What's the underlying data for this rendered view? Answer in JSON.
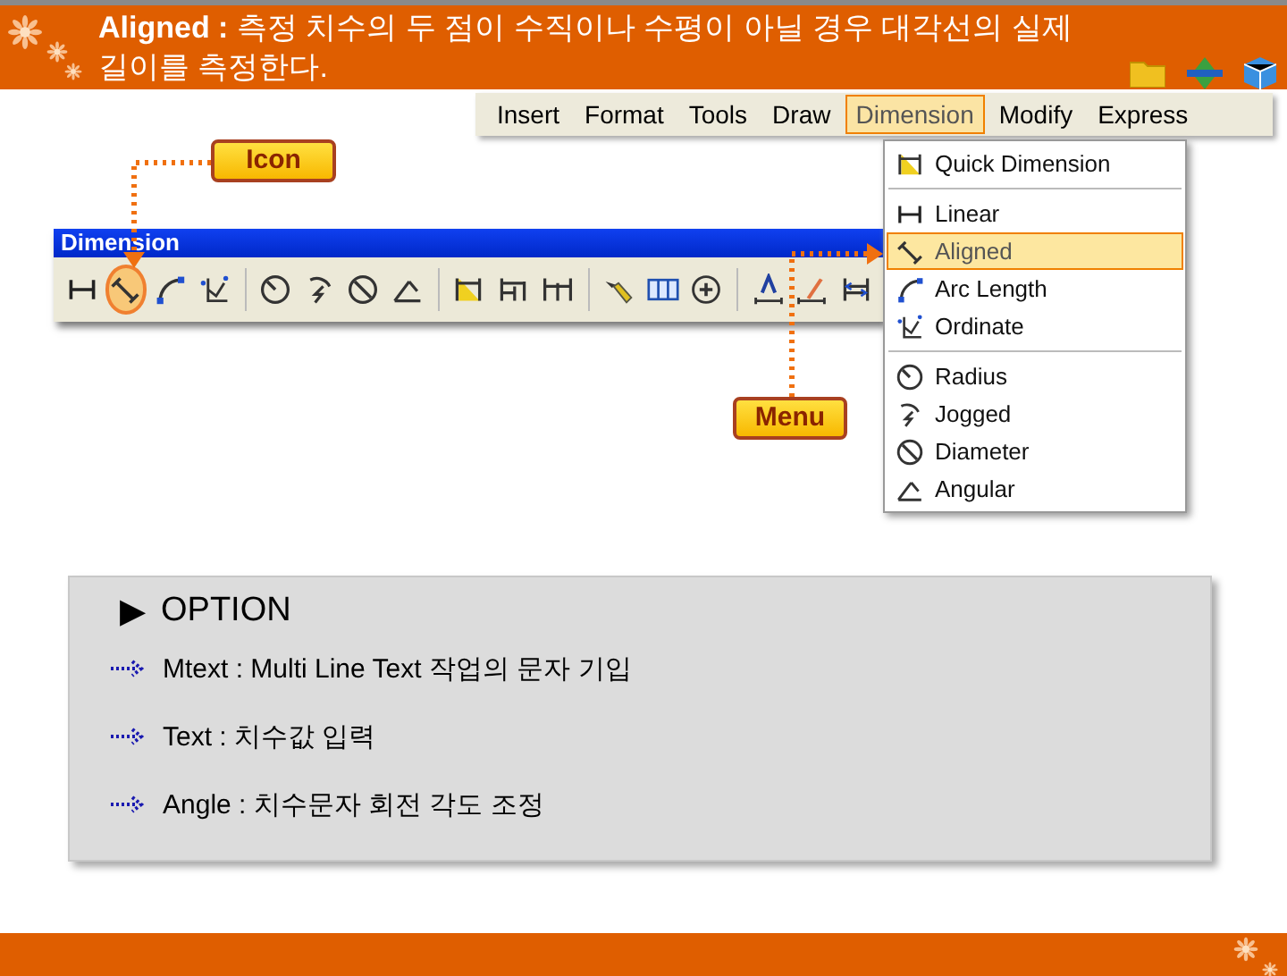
{
  "header": {
    "title": "**Aligned :** 측정 치수의 두 점이 수직이나 수평이 아닐 경우 대각선의 실제 길이를 측정한다."
  },
  "menubar": {
    "items": [
      {
        "label": "Insert",
        "selected": false
      },
      {
        "label": "Format",
        "selected": false
      },
      {
        "label": "Tools",
        "selected": false
      },
      {
        "label": "Draw",
        "selected": false
      },
      {
        "label": "Dimension",
        "selected": true
      },
      {
        "label": "Modify",
        "selected": false
      },
      {
        "label": "Express",
        "selected": false
      }
    ]
  },
  "dropdown": {
    "groups": [
      {
        "items": [
          {
            "label": "Quick Dimension",
            "kind": "quick",
            "selected": false
          }
        ]
      },
      {
        "items": [
          {
            "label": "Linear",
            "kind": "linear",
            "selected": false
          },
          {
            "label": "Aligned",
            "kind": "aligned",
            "selected": true
          },
          {
            "label": "Arc Length",
            "kind": "arc",
            "selected": false
          },
          {
            "label": "Ordinate",
            "kind": "ordinate",
            "selected": false
          }
        ]
      },
      {
        "items": [
          {
            "label": "Radius",
            "kind": "radius",
            "selected": false
          },
          {
            "label": "Jogged",
            "kind": "jogged",
            "selected": false
          },
          {
            "label": "Diameter",
            "kind": "diameter",
            "selected": false
          },
          {
            "label": "Angular",
            "kind": "angular",
            "selected": false
          }
        ]
      }
    ]
  },
  "toolbar": {
    "title": "Dimension",
    "groups": [
      {
        "tools": [
          {
            "kind": "linear",
            "selected": false
          },
          {
            "kind": "aligned",
            "selected": true
          },
          {
            "kind": "arc",
            "selected": false
          },
          {
            "kind": "ordinate",
            "selected": false
          }
        ]
      },
      {
        "tools": [
          {
            "kind": "radius",
            "selected": false
          },
          {
            "kind": "jogged",
            "selected": false
          },
          {
            "kind": "diameter",
            "selected": false
          },
          {
            "kind": "angular",
            "selected": false
          }
        ]
      },
      {
        "tools": [
          {
            "kind": "quick",
            "selected": false
          },
          {
            "kind": "baseline",
            "selected": false
          },
          {
            "kind": "continue",
            "selected": false
          }
        ]
      },
      {
        "tools": [
          {
            "kind": "leader",
            "selected": false
          },
          {
            "kind": "tolerance",
            "selected": false
          },
          {
            "kind": "center",
            "selected": false
          }
        ]
      },
      {
        "tools": [
          {
            "kind": "textedit",
            "selected": false
          },
          {
            "kind": "dimedit",
            "selected": false
          },
          {
            "kind": "update",
            "selected": false
          }
        ]
      }
    ]
  },
  "callouts": [
    {
      "text": "Icon"
    },
    {
      "text": "Menu"
    }
  ],
  "options": {
    "heading": "OPTION",
    "marker": "▶",
    "items": [
      "Mtext : Multi Line Text 작업의 문자 기입",
      "Text : 치수값 입력",
      "Angle : 치수문자 회전 각도 조정"
    ]
  }
}
